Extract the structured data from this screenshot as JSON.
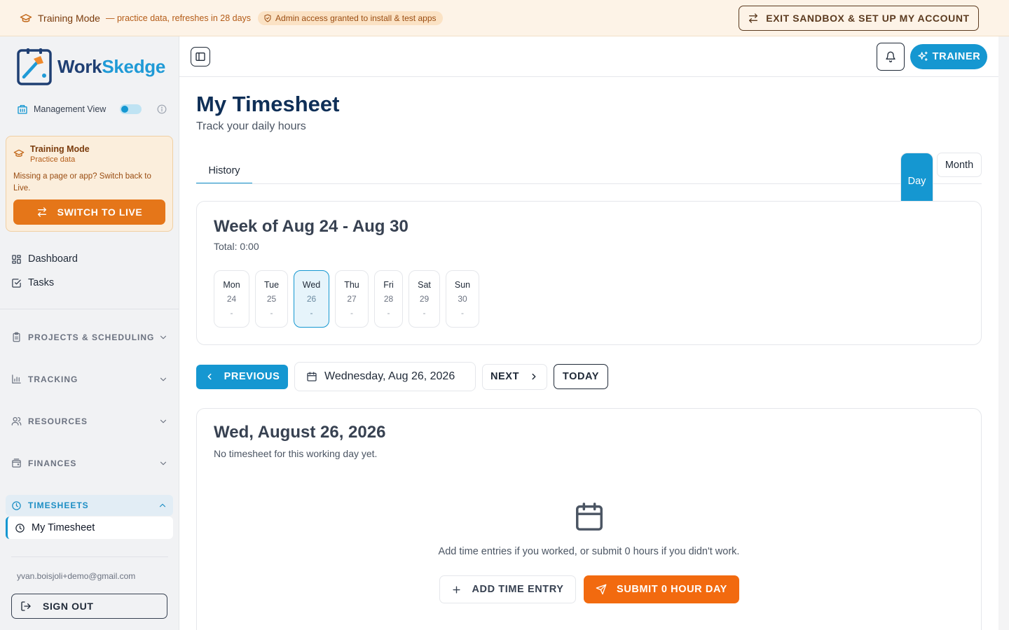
{
  "banner": {
    "mode_label": "Training Mode",
    "mode_sub": "— practice data, refreshes in 28 days",
    "admin_pill": "Admin access granted to install & test apps",
    "exit_button": "EXIT SANDBOX & SET UP MY ACCOUNT"
  },
  "sidebar": {
    "logo_word_1": "Work",
    "logo_word_2": "Skedge",
    "management_view_label": "Management View",
    "management_view_on": true,
    "training_card": {
      "title": "Training Mode",
      "subtitle": "Practice data",
      "message": "Missing a page or app? Switch back to Live.",
      "button": "SWITCH TO LIVE"
    },
    "nav": [
      {
        "label": "Dashboard",
        "icon": "grid-icon"
      },
      {
        "label": "Tasks",
        "icon": "checkbox-icon"
      }
    ],
    "sections": [
      {
        "label": "PROJECTS & SCHEDULING",
        "icon": "clipboard-icon",
        "expanded": false
      },
      {
        "label": "TRACKING",
        "icon": "bar-chart-icon",
        "expanded": false
      },
      {
        "label": "RESOURCES",
        "icon": "users-icon",
        "expanded": false
      },
      {
        "label": "FINANCES",
        "icon": "wallet-icon",
        "expanded": false
      },
      {
        "label": "TIMESHEETS",
        "icon": "clock-icon",
        "expanded": true
      }
    ],
    "active_subitem": "My Timesheet",
    "user_email": "yvan.boisjoli+demo@gmail.com",
    "sign_out": "SIGN OUT"
  },
  "header": {
    "trainer_button": "TRAINER"
  },
  "page": {
    "title": "My Timesheet",
    "subtitle": "Track your daily hours",
    "tabs": [
      {
        "label": "History",
        "active": true
      }
    ],
    "view_modes": [
      {
        "label": "Day",
        "active": true
      },
      {
        "label": "Month",
        "active": false
      }
    ]
  },
  "week": {
    "title": "Week of Aug 24 - Aug 30",
    "total": "Total: 0:00",
    "days": [
      {
        "name": "Mon",
        "date": "24",
        "hours": "-",
        "selected": false
      },
      {
        "name": "Tue",
        "date": "25",
        "hours": "-",
        "selected": false
      },
      {
        "name": "Wed",
        "date": "26",
        "hours": "-",
        "selected": true
      },
      {
        "name": "Thu",
        "date": "27",
        "hours": "-",
        "selected": false
      },
      {
        "name": "Fri",
        "date": "28",
        "hours": "-",
        "selected": false
      },
      {
        "name": "Sat",
        "date": "29",
        "hours": "-",
        "selected": false
      },
      {
        "name": "Sun",
        "date": "30",
        "hours": "-",
        "selected": false
      }
    ]
  },
  "date_nav": {
    "previous": "PREVIOUS",
    "current_date": "Wednesday, Aug 26, 2026",
    "next": "NEXT",
    "today": "TODAY"
  },
  "day_detail": {
    "title": "Wed, August 26, 2026",
    "message": "No timesheet for this working day yet.",
    "empty_text": "Add time entries if you worked, or submit 0 hours if you didn't work.",
    "add_button": "ADD TIME ENTRY",
    "submit_button": "SUBMIT 0 HOUR DAY"
  },
  "colors": {
    "accent": "#1597d1",
    "brand_navy": "#0f2f57",
    "training_orange": "#e57619",
    "submit_orange": "#f26a0f"
  }
}
